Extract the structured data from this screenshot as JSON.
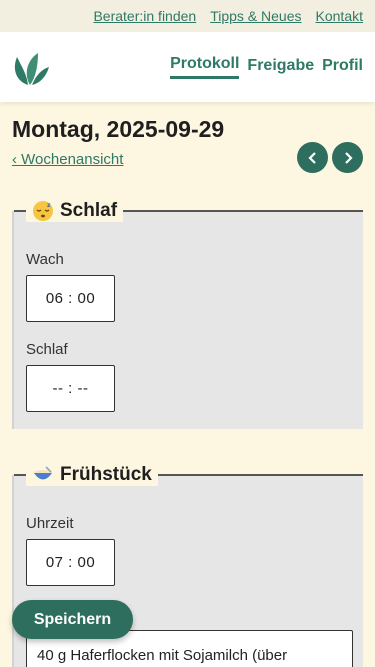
{
  "topbar": {
    "links": [
      "Berater:in finden",
      "Tipps & Neues",
      "Kontakt"
    ]
  },
  "nav": {
    "links": [
      "Protokoll",
      "Freigabe",
      "Profil"
    ],
    "active": "Protokoll"
  },
  "day": {
    "title": "Montag, 2025-09-29",
    "week_link": "‹ Wochenansicht",
    "prev_icon": "chevron-left-icon",
    "next_icon": "chevron-right-icon"
  },
  "sleep": {
    "title": "Schlaf",
    "icon": "sleeping-face-icon",
    "wake_label": "Wach",
    "wake_value": "06 : 00",
    "sleep_label": "Schlaf",
    "sleep_value": "-- : --"
  },
  "breakfast": {
    "title": "Frühstück",
    "icon": "bowl-icon",
    "time_label": "Uhrzeit",
    "time_value": "07 : 00",
    "text_value": "40 g Haferflocken mit Sojamilch (über"
  },
  "save_label": "Speichern",
  "colors": {
    "accent": "#2e7a66",
    "button": "#2e6e5e",
    "background": "#fdf6e0",
    "section": "#e6e6e6"
  }
}
